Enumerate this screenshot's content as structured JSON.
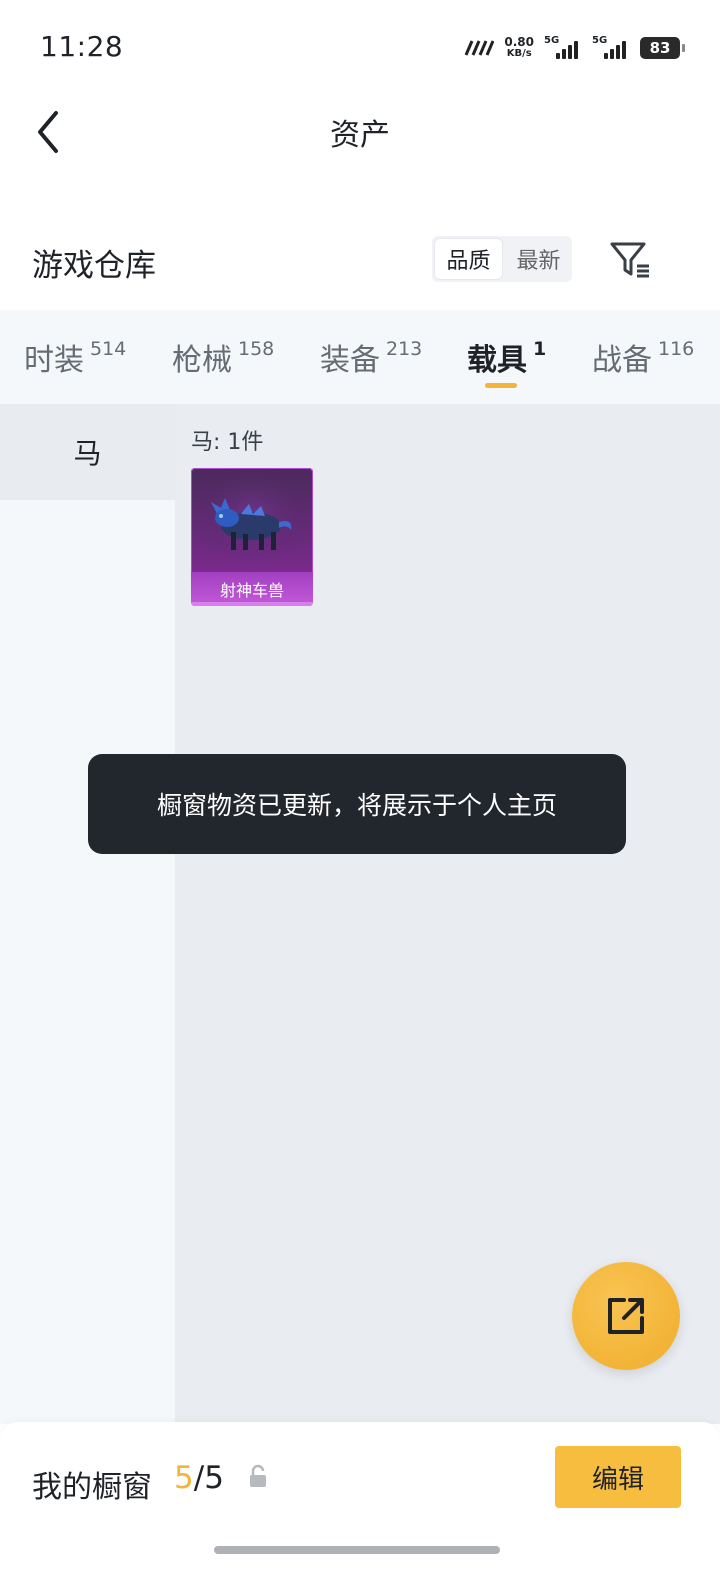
{
  "status_bar": {
    "time": "11:28",
    "net_speed": "0.80",
    "net_unit": "KB/s",
    "sim1_label": "5G",
    "sim2_label": "5G",
    "battery": "83"
  },
  "header": {
    "title": "资产",
    "back_icon": "chevron-left-icon"
  },
  "warehouse": {
    "title": "游戏仓库",
    "sort_options": [
      "品质",
      "最新"
    ],
    "active_sort": "品质",
    "filter_icon": "filter-icon"
  },
  "tabs": [
    {
      "label": "时装",
      "count": "514",
      "active": false
    },
    {
      "label": "枪械",
      "count": "158",
      "active": false
    },
    {
      "label": "装备",
      "count": "213",
      "active": false
    },
    {
      "label": "载具",
      "count": "1",
      "active": true
    },
    {
      "label": "战备",
      "count": "116",
      "active": false
    }
  ],
  "categories": [
    {
      "label": "马",
      "active": true
    }
  ],
  "content": {
    "count_label": "马: 1件",
    "items": [
      {
        "name": "射神车兽",
        "rarity_color": "#8e2aa0"
      }
    ]
  },
  "toast": {
    "message": "橱窗物资已更新，将展示于个人主页"
  },
  "fab": {
    "icon": "share-icon"
  },
  "bottom_bar": {
    "label": "我的橱窗",
    "used": "5",
    "separator": "/",
    "total": "5",
    "lock_icon": "lock-icon",
    "edit_label": "编辑"
  },
  "colors": {
    "accent": "#f4b43a",
    "edit_button": "#f6bd3e",
    "toast_bg": "#22262d"
  }
}
